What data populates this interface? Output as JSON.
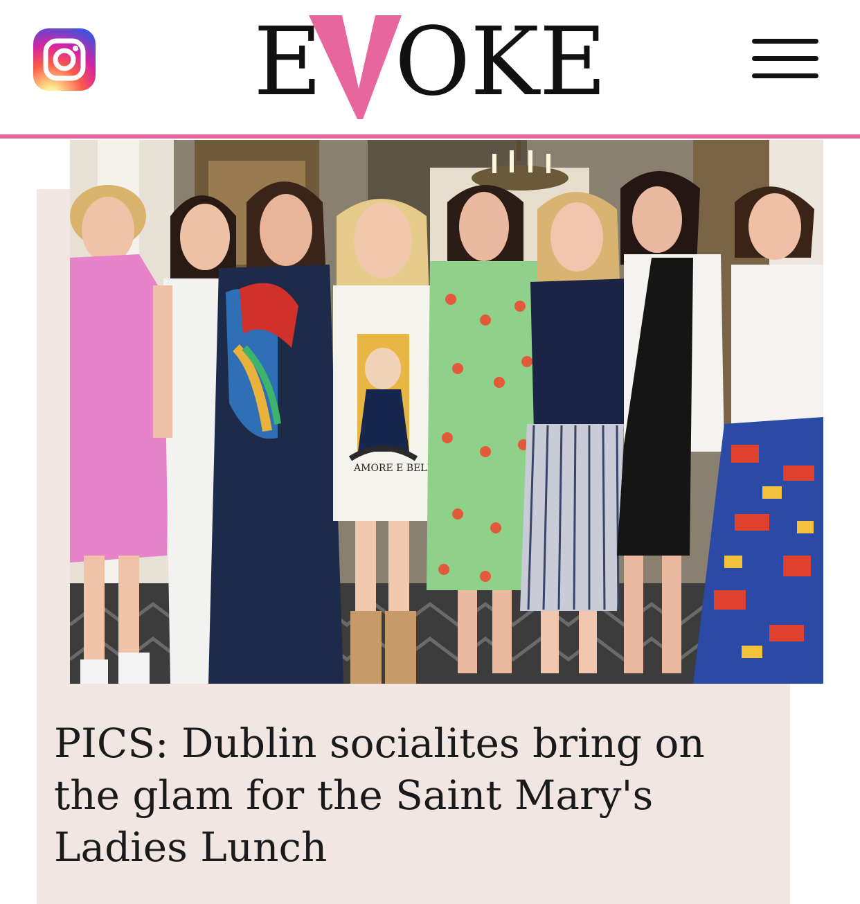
{
  "header": {
    "logo_text": "EVOKE",
    "instagram_icon": "instagram-icon",
    "menu_icon": "hamburger-menu-icon"
  },
  "article": {
    "headline": "PICS: Dublin socialites bring on the glam for the Saint Mary's Ladies Lunch",
    "image_alt": "Group photo of eight women at the Saint Mary's Ladies Lunch",
    "dress_print_text": "AMORE E BELLEZZA"
  },
  "colors": {
    "brand_pink": "#e8669e",
    "logo_dark": "#111111",
    "card_background": "#f2e6e3",
    "headline_text": "#1a1a1a"
  }
}
